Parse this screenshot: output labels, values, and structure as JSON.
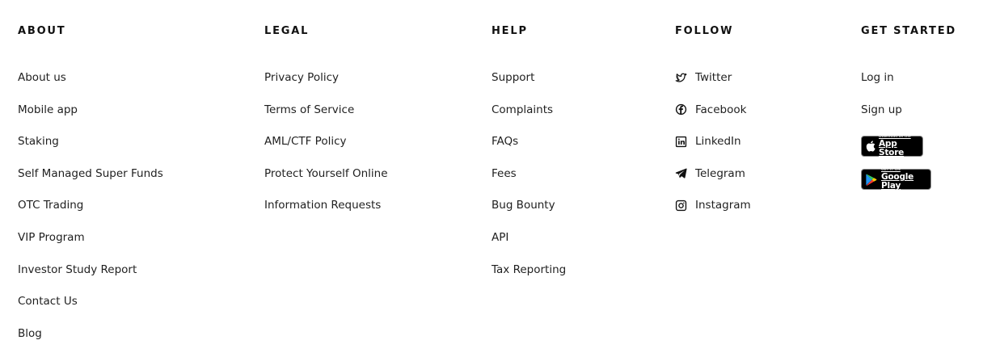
{
  "columns": {
    "about": {
      "heading": "ABOUT",
      "links": [
        "About us",
        "Mobile app",
        "Staking",
        "Self Managed Super Funds",
        "OTC Trading",
        "VIP Program",
        "Investor Study Report",
        "Contact Us",
        "Blog"
      ]
    },
    "legal": {
      "heading": "LEGAL",
      "links": [
        "Privacy Policy",
        "Terms of Service",
        "AML/CTF Policy",
        "Protect Yourself Online",
        "Information Requests"
      ]
    },
    "help": {
      "heading": "HELP",
      "links": [
        "Support",
        "Complaints",
        "FAQs",
        "Fees",
        "Bug Bounty",
        "API",
        "Tax Reporting"
      ]
    },
    "follow": {
      "heading": "FOLLOW",
      "links": [
        {
          "label": "Twitter",
          "icon": "twitter-icon"
        },
        {
          "label": "Facebook",
          "icon": "facebook-icon"
        },
        {
          "label": "LinkedIn",
          "icon": "linkedin-icon"
        },
        {
          "label": "Telegram",
          "icon": "telegram-icon"
        },
        {
          "label": "Instagram",
          "icon": "instagram-icon"
        }
      ]
    },
    "get_started": {
      "heading": "GET STARTED",
      "links": [
        "Log in",
        "Sign up"
      ],
      "app_store": {
        "small": "Download on the",
        "big": "App Store",
        "icon": "apple-icon"
      },
      "google_play": {
        "small": "GET IT ON",
        "big": "Google Play",
        "icon": "google-play-icon"
      }
    }
  },
  "colors": {
    "text": "#1f1f1f",
    "heading": "#111111",
    "badge_bg": "#000000"
  }
}
